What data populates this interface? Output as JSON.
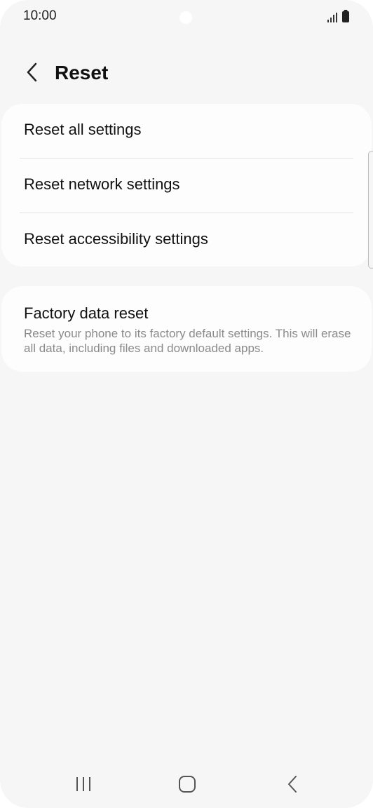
{
  "status_bar": {
    "time": "10:00",
    "icons": [
      "signal-icon",
      "battery-icon"
    ]
  },
  "header": {
    "back_icon": "chevron-left-icon",
    "title": "Reset"
  },
  "reset_options": [
    {
      "label": "Reset all settings"
    },
    {
      "label": "Reset network settings"
    },
    {
      "label": "Reset accessibility settings"
    }
  ],
  "factory_reset": {
    "title": "Factory data reset",
    "description": "Reset your phone to its factory default settings. This will erase all data, including files and downloaded apps."
  },
  "nav_bar": {
    "icons": [
      "recent-apps-icon",
      "home-icon",
      "back-icon"
    ]
  },
  "colors": {
    "background": "#f6f6f6",
    "card": "#fdfdfd",
    "text_primary": "#111111",
    "text_secondary": "#8a8a8a",
    "divider": "#e3e3e3"
  }
}
